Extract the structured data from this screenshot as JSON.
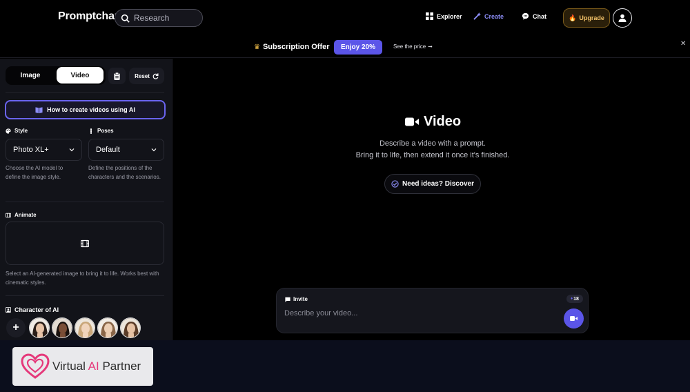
{
  "nav": {
    "logo": "Promptchan",
    "search_placeholder": "Research",
    "explorer": "Explorer",
    "create": "Create",
    "chat": "Chat",
    "upgrade": "Upgrade"
  },
  "promo": {
    "title": "Subscription Offer",
    "button": "Enjoy 20%",
    "link": "See the price",
    "link_arrow": "➞",
    "close": "✕"
  },
  "sidebar": {
    "mode_image": "Image",
    "mode_video": "Video",
    "reset": "Reset",
    "howto": "How to create videos using AI",
    "style_label": "Style",
    "style_value": "Photo XL+",
    "style_desc": "Choose the AI model to define the image style.",
    "poses_label": "Poses",
    "poses_value": "Default",
    "poses_desc": "Define the positions of the characters and the scenarios.",
    "animate_label": "Animate",
    "animate_desc": "Select an AI-generated image to bring it to life. Works best with cinematic styles.",
    "character_label": "Character of AI",
    "add_symbol": "+"
  },
  "main": {
    "title": "Video",
    "desc_line1": "Describe a video with a prompt.",
    "desc_line2": "Bring it to life, then extend it once it's finished.",
    "ideas": "Need ideas? Discover"
  },
  "prompt": {
    "invite": "Invite",
    "credits": "18",
    "placeholder": "Describe your video..."
  },
  "watermark": {
    "text_a": "Virtual ",
    "text_ai": "AI",
    "text_b": " Partner"
  },
  "colors": {
    "accent": "#5b55e8",
    "create_active": "#8b8cf5",
    "upgrade_gold": "#f4c36a"
  }
}
